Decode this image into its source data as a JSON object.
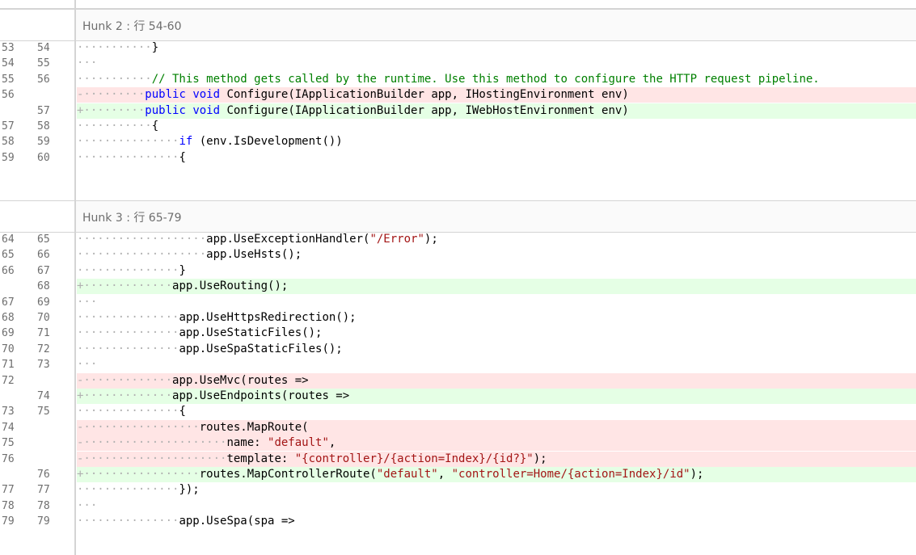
{
  "hunks": [
    {
      "title": "Hunk 2 : 行 54-60",
      "lines": [
        {
          "old": "53",
          "new": "54",
          "type": "ctx",
          "dots": "···········",
          "tokens": [
            {
              "t": "}",
              "c": ""
            }
          ]
        },
        {
          "old": "54",
          "new": "55",
          "type": "ctx",
          "dots": "···",
          "tokens": []
        },
        {
          "old": "55",
          "new": "56",
          "type": "ctx",
          "dots": "···········",
          "tokens": [
            {
              "t": "// This method gets called by the runtime. Use this method to configure the HTTP request pipeline.",
              "c": "cmt"
            }
          ]
        },
        {
          "old": "56",
          "new": "",
          "type": "del",
          "dots": "-·········",
          "tokens": [
            {
              "t": "public",
              "c": "kw"
            },
            {
              "t": " ",
              "c": ""
            },
            {
              "t": "void",
              "c": "kw"
            },
            {
              "t": " Configure(IApplicationBuilder app, IHostingEnvironment env)",
              "c": ""
            }
          ]
        },
        {
          "old": "",
          "new": "57",
          "type": "add",
          "dots": "+·········",
          "tokens": [
            {
              "t": "public",
              "c": "kw"
            },
            {
              "t": " ",
              "c": ""
            },
            {
              "t": "void",
              "c": "kw"
            },
            {
              "t": " Configure(IApplicationBuilder app, IWebHostEnvironment env)",
              "c": ""
            }
          ]
        },
        {
          "old": "57",
          "new": "58",
          "type": "ctx",
          "dots": "···········",
          "tokens": [
            {
              "t": "{",
              "c": ""
            }
          ]
        },
        {
          "old": "58",
          "new": "59",
          "type": "ctx",
          "dots": "···············",
          "tokens": [
            {
              "t": "if",
              "c": "kw"
            },
            {
              "t": " (env.IsDevelopment())",
              "c": ""
            }
          ]
        },
        {
          "old": "59",
          "new": "60",
          "type": "ctx",
          "dots": "···············",
          "tokens": [
            {
              "t": "{",
              "c": ""
            }
          ]
        }
      ]
    },
    {
      "title": "Hunk 3 : 行 65-79",
      "lines": [
        {
          "old": "64",
          "new": "65",
          "type": "ctx",
          "dots": "···················",
          "tokens": [
            {
              "t": "app.UseExceptionHandler(",
              "c": ""
            },
            {
              "t": "\"/Error\"",
              "c": "str"
            },
            {
              "t": ");",
              "c": ""
            }
          ]
        },
        {
          "old": "65",
          "new": "66",
          "type": "ctx",
          "dots": "···················",
          "tokens": [
            {
              "t": "app.UseHsts();",
              "c": ""
            }
          ]
        },
        {
          "old": "66",
          "new": "67",
          "type": "ctx",
          "dots": "···············",
          "tokens": [
            {
              "t": "}",
              "c": ""
            }
          ]
        },
        {
          "old": "",
          "new": "68",
          "type": "add",
          "dots": "+·············",
          "tokens": [
            {
              "t": "app.UseRouting();",
              "c": ""
            }
          ]
        },
        {
          "old": "67",
          "new": "69",
          "type": "ctx",
          "dots": "···",
          "tokens": []
        },
        {
          "old": "68",
          "new": "70",
          "type": "ctx",
          "dots": "···············",
          "tokens": [
            {
              "t": "app.UseHttpsRedirection();",
              "c": ""
            }
          ]
        },
        {
          "old": "69",
          "new": "71",
          "type": "ctx",
          "dots": "···············",
          "tokens": [
            {
              "t": "app.UseStaticFiles();",
              "c": ""
            }
          ]
        },
        {
          "old": "70",
          "new": "72",
          "type": "ctx",
          "dots": "···············",
          "tokens": [
            {
              "t": "app.UseSpaStaticFiles();",
              "c": ""
            }
          ]
        },
        {
          "old": "71",
          "new": "73",
          "type": "ctx",
          "dots": "···",
          "tokens": []
        },
        {
          "old": "72",
          "new": "",
          "type": "del",
          "dots": "-·············",
          "tokens": [
            {
              "t": "app.UseMvc(routes =>",
              "c": ""
            }
          ]
        },
        {
          "old": "",
          "new": "74",
          "type": "add",
          "dots": "+·············",
          "tokens": [
            {
              "t": "app.UseEndpoints(routes =>",
              "c": ""
            }
          ]
        },
        {
          "old": "73",
          "new": "75",
          "type": "ctx",
          "dots": "···············",
          "tokens": [
            {
              "t": "{",
              "c": ""
            }
          ]
        },
        {
          "old": "74",
          "new": "",
          "type": "del",
          "dots": "-·················",
          "tokens": [
            {
              "t": "routes.MapRoute(",
              "c": ""
            }
          ]
        },
        {
          "old": "75",
          "new": "",
          "type": "del",
          "dots": "-·····················",
          "tokens": [
            {
              "t": "name: ",
              "c": ""
            },
            {
              "t": "\"default\"",
              "c": "str"
            },
            {
              "t": ",",
              "c": ""
            }
          ]
        },
        {
          "old": "76",
          "new": "",
          "type": "del",
          "dots": "-·····················",
          "tokens": [
            {
              "t": "template: ",
              "c": ""
            },
            {
              "t": "\"{controller}/{action=Index}/{id?}\"",
              "c": "str"
            },
            {
              "t": ");",
              "c": ""
            }
          ]
        },
        {
          "old": "",
          "new": "76",
          "type": "add",
          "dots": "+·················",
          "tokens": [
            {
              "t": "routes.MapControllerRoute(",
              "c": ""
            },
            {
              "t": "\"default\"",
              "c": "str"
            },
            {
              "t": ", ",
              "c": ""
            },
            {
              "t": "\"controller=Home/{action=Index}/id\"",
              "c": "str"
            },
            {
              "t": ");",
              "c": ""
            }
          ]
        },
        {
          "old": "77",
          "new": "77",
          "type": "ctx",
          "dots": "···············",
          "tokens": [
            {
              "t": "});",
              "c": ""
            }
          ]
        },
        {
          "old": "78",
          "new": "78",
          "type": "ctx",
          "dots": "···",
          "tokens": []
        },
        {
          "old": "79",
          "new": "79",
          "type": "ctx",
          "dots": "···············",
          "tokens": [
            {
              "t": "app.UseSpa(spa =>",
              "c": ""
            }
          ]
        }
      ]
    }
  ]
}
